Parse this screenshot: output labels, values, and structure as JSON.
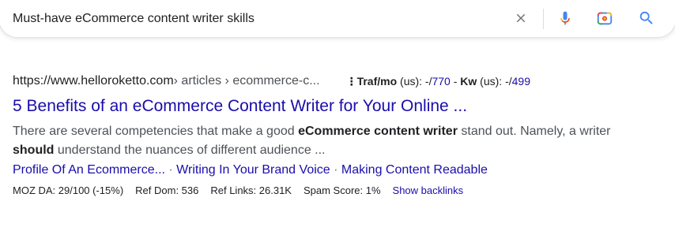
{
  "search": {
    "query": "Must-have eCommerce content writer skills",
    "clear_icon": "close-icon",
    "voice_icon": "mic-icon",
    "lens_icon": "camera-lens-icon",
    "search_icon": "search-icon"
  },
  "result": {
    "url_base": "https://www.helloroketto.com",
    "url_path": " › articles › ecommerce-c...",
    "seo": {
      "traf_label": "Traf/mo",
      "traf_region": " (us): ",
      "traf_prefix": "-/",
      "traf_value": "770",
      "sep": " - ",
      "kw_label": "Kw",
      "kw_region": " (us): ",
      "kw_prefix": "-/",
      "kw_value": "499"
    },
    "title": "5 Benefits of an eCommerce Content Writer for Your Online ...",
    "snippet": {
      "p1": "There are several competencies that make a good ",
      "b1": "eCommerce content writer",
      "p2": " stand out. Namely, a writer ",
      "b2": "should",
      "p3": " understand the nuances of different audience ..."
    },
    "sitelinks": [
      "Profile Of An Ecommerce...",
      "Writing In Your Brand Voice",
      "Making Content Readable"
    ],
    "sitelink_sep": " · ",
    "moz": {
      "da": "MOZ DA: 29/100 (-15%)",
      "ref_dom": "Ref Dom: 536",
      "ref_links": "Ref Links: 26.31K",
      "spam": "Spam Score: 1%",
      "backlinks_label": "Show backlinks"
    }
  },
  "colors": {
    "link": "#1a0dab",
    "text": "#202124",
    "muted": "#4d5156",
    "google_blue": "#4285f4",
    "google_red": "#ea4335",
    "google_yellow": "#fbbc04",
    "google_green": "#34a853"
  }
}
